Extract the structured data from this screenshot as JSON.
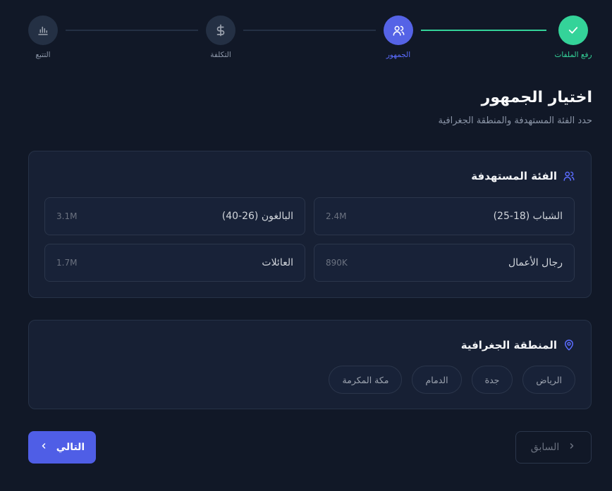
{
  "stepper": {
    "steps": [
      {
        "label": "رفع الملفات",
        "state": "done",
        "icon": "check-icon"
      },
      {
        "label": "الجمهور",
        "state": "active",
        "icon": "users-icon"
      },
      {
        "label": "التكلفة",
        "state": "pending",
        "icon": "dollar-icon"
      },
      {
        "label": "التتبع",
        "state": "pending",
        "icon": "bar-chart-icon"
      }
    ]
  },
  "header": {
    "title": "اختيار الجمهور",
    "subtitle": "حدد الفئة المستهدفة والمنطقة الجغرافية"
  },
  "audience": {
    "title": "الفئة المستهدفة",
    "icon": "users-icon",
    "options": [
      {
        "label": "الشباب (18-25)",
        "reach": "2.4M"
      },
      {
        "label": "البالغون (26-40)",
        "reach": "3.1M"
      },
      {
        "label": "رجال الأعمال",
        "reach": "890K"
      },
      {
        "label": "العائلات",
        "reach": "1.7M"
      }
    ]
  },
  "region": {
    "title": "المنطقة الجغرافية",
    "icon": "map-pin-icon",
    "cities": [
      "الرياض",
      "جدة",
      "الدمام",
      "مكة المكرمة"
    ]
  },
  "actions": {
    "next_label": "التالي",
    "prev_label": "السابق"
  },
  "colors": {
    "background": "#111827",
    "card": "#172034",
    "accent": "#5563e6",
    "success": "#34d399"
  }
}
